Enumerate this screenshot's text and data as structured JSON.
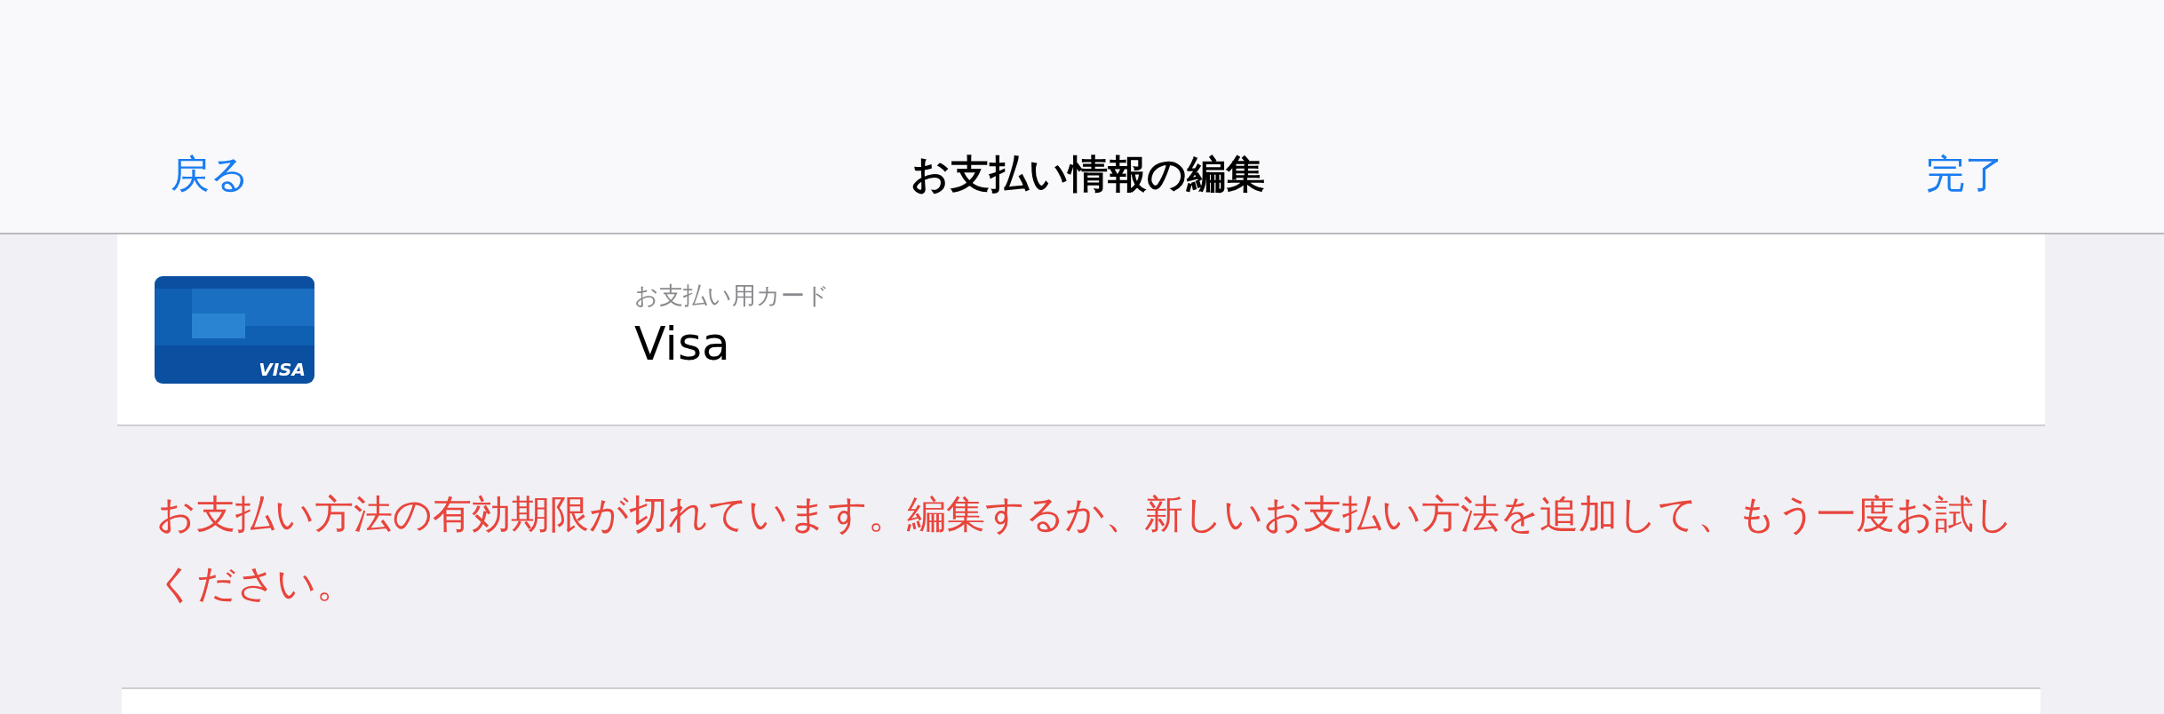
{
  "nav": {
    "back": "戻る",
    "title": "お支払い情報の編集",
    "done": "完了"
  },
  "payment": {
    "label": "お支払い用カード",
    "name": "Visa",
    "card_brand": "VISA"
  },
  "error": "お支払い方法の有効期限が切れています。編集するか、新しいお支払い方法を追加して、もう一度お試しください。"
}
